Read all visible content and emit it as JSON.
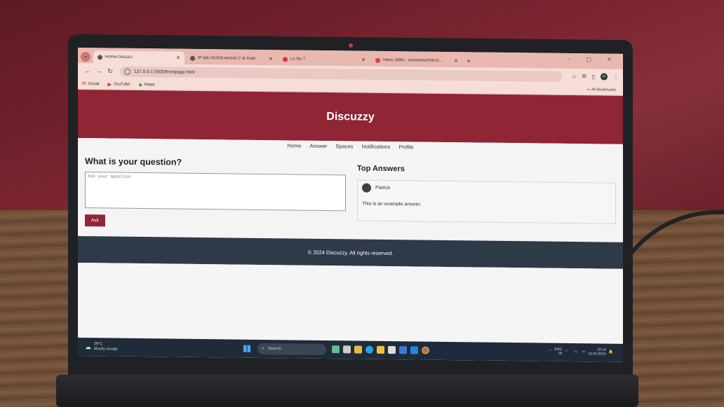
{
  "browser": {
    "tabs": [
      {
        "label": "Home-Discuzz",
        "active": true
      },
      {
        "label": "IP-lab-2024/Exercise-2 at main",
        "active": false
      },
      {
        "label": "Lo No 7",
        "active": false
      },
      {
        "label": "Inbox (996) - naveenkarthik20...",
        "active": false
      }
    ],
    "address": "127.0.0.1:5500/frontpage.html",
    "bookmarks": [
      "Gmail",
      "YouTube",
      "Maps"
    ],
    "all_bookmarks": "All Bookmarks",
    "profile_initial": "N"
  },
  "site": {
    "title": "Discuzzy",
    "nav": [
      "Home",
      "Answer",
      "Spaces",
      "Notifications",
      "Profile"
    ],
    "ask": {
      "heading": "What is your question?",
      "placeholder": "Ask your question",
      "button": "Ask"
    },
    "answers": {
      "heading": "Top Answers",
      "author": "Patrick",
      "text": "This is an example answer."
    },
    "footer": "© 2024 Discuzzy. All rights reserved."
  },
  "taskbar": {
    "weather_temp": "29°C",
    "weather_desc": "Mostly cloudy",
    "search": "Search",
    "lang_1": "ENG",
    "lang_2": "IN",
    "time": "22:14",
    "date": "14-03-2024"
  },
  "colors": {
    "brand": "#8f2535",
    "footer": "#2e3a48",
    "taskbar": "#1f2b3a"
  }
}
